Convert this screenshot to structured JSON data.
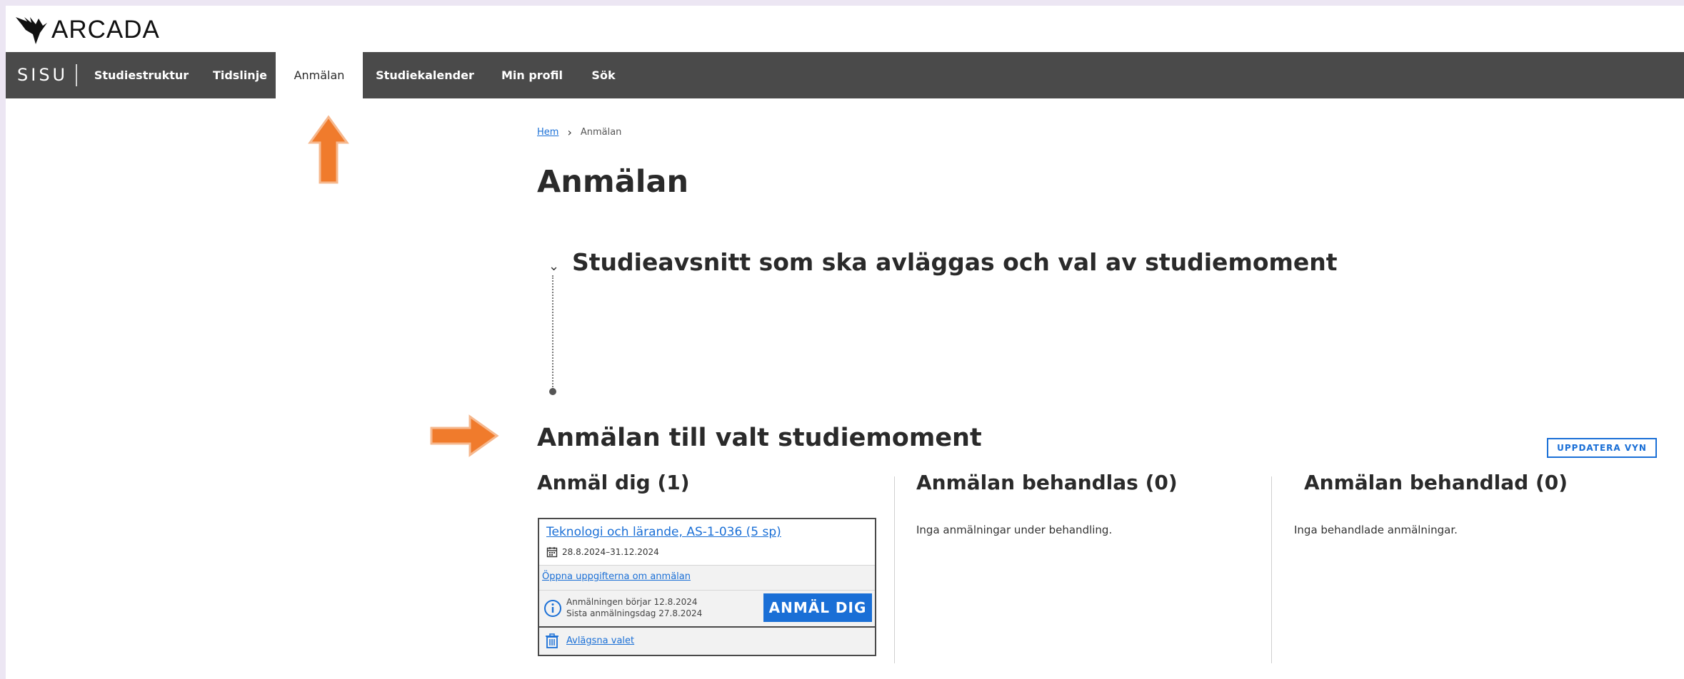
{
  "brand": {
    "logo_text": "ARCADA",
    "app_name": "SISU"
  },
  "nav": {
    "items": [
      {
        "label": "Studiestruktur"
      },
      {
        "label": "Tidslinje"
      },
      {
        "label": "Anmälan",
        "active": true
      },
      {
        "label": "Studiekalender"
      },
      {
        "label": "Min profil"
      },
      {
        "label": "Sök"
      }
    ]
  },
  "breadcrumb": {
    "home": "Hem",
    "current": "Anmälan"
  },
  "page_title": "Anmälan",
  "section": {
    "title": "Studieavsnitt som ska avläggas och val av studiemoment"
  },
  "registration": {
    "title": "Anmälan till valt studiemoment",
    "refresh_label": "UPPDATERA VYN",
    "columns": [
      {
        "title": "Anmäl dig (1)"
      },
      {
        "title": "Anmälan behandlas (0)",
        "empty_text": "Inga anmälningar under behandling."
      },
      {
        "title": "Anmälan behandlad (0)",
        "empty_text": "Inga behandlade anmälningar."
      }
    ],
    "card": {
      "course_link": "Teknologi och lärande, AS-1-036 (5 sp)",
      "date_range": "28.8.2024–31.12.2024",
      "open_details": "Öppna uppgifterna om anmälan",
      "info_line1": "Anmälningen börjar 12.8.2024",
      "info_line2": "Sista anmälningsdag 27.8.2024",
      "register_label": "ANMÄL DIG",
      "remove_label": "Avlägsna valet"
    }
  },
  "colors": {
    "nav_bg": "#4a4a4a",
    "accent_blue": "#1a6fd6",
    "annotation_arrow": "#f07b2c"
  }
}
